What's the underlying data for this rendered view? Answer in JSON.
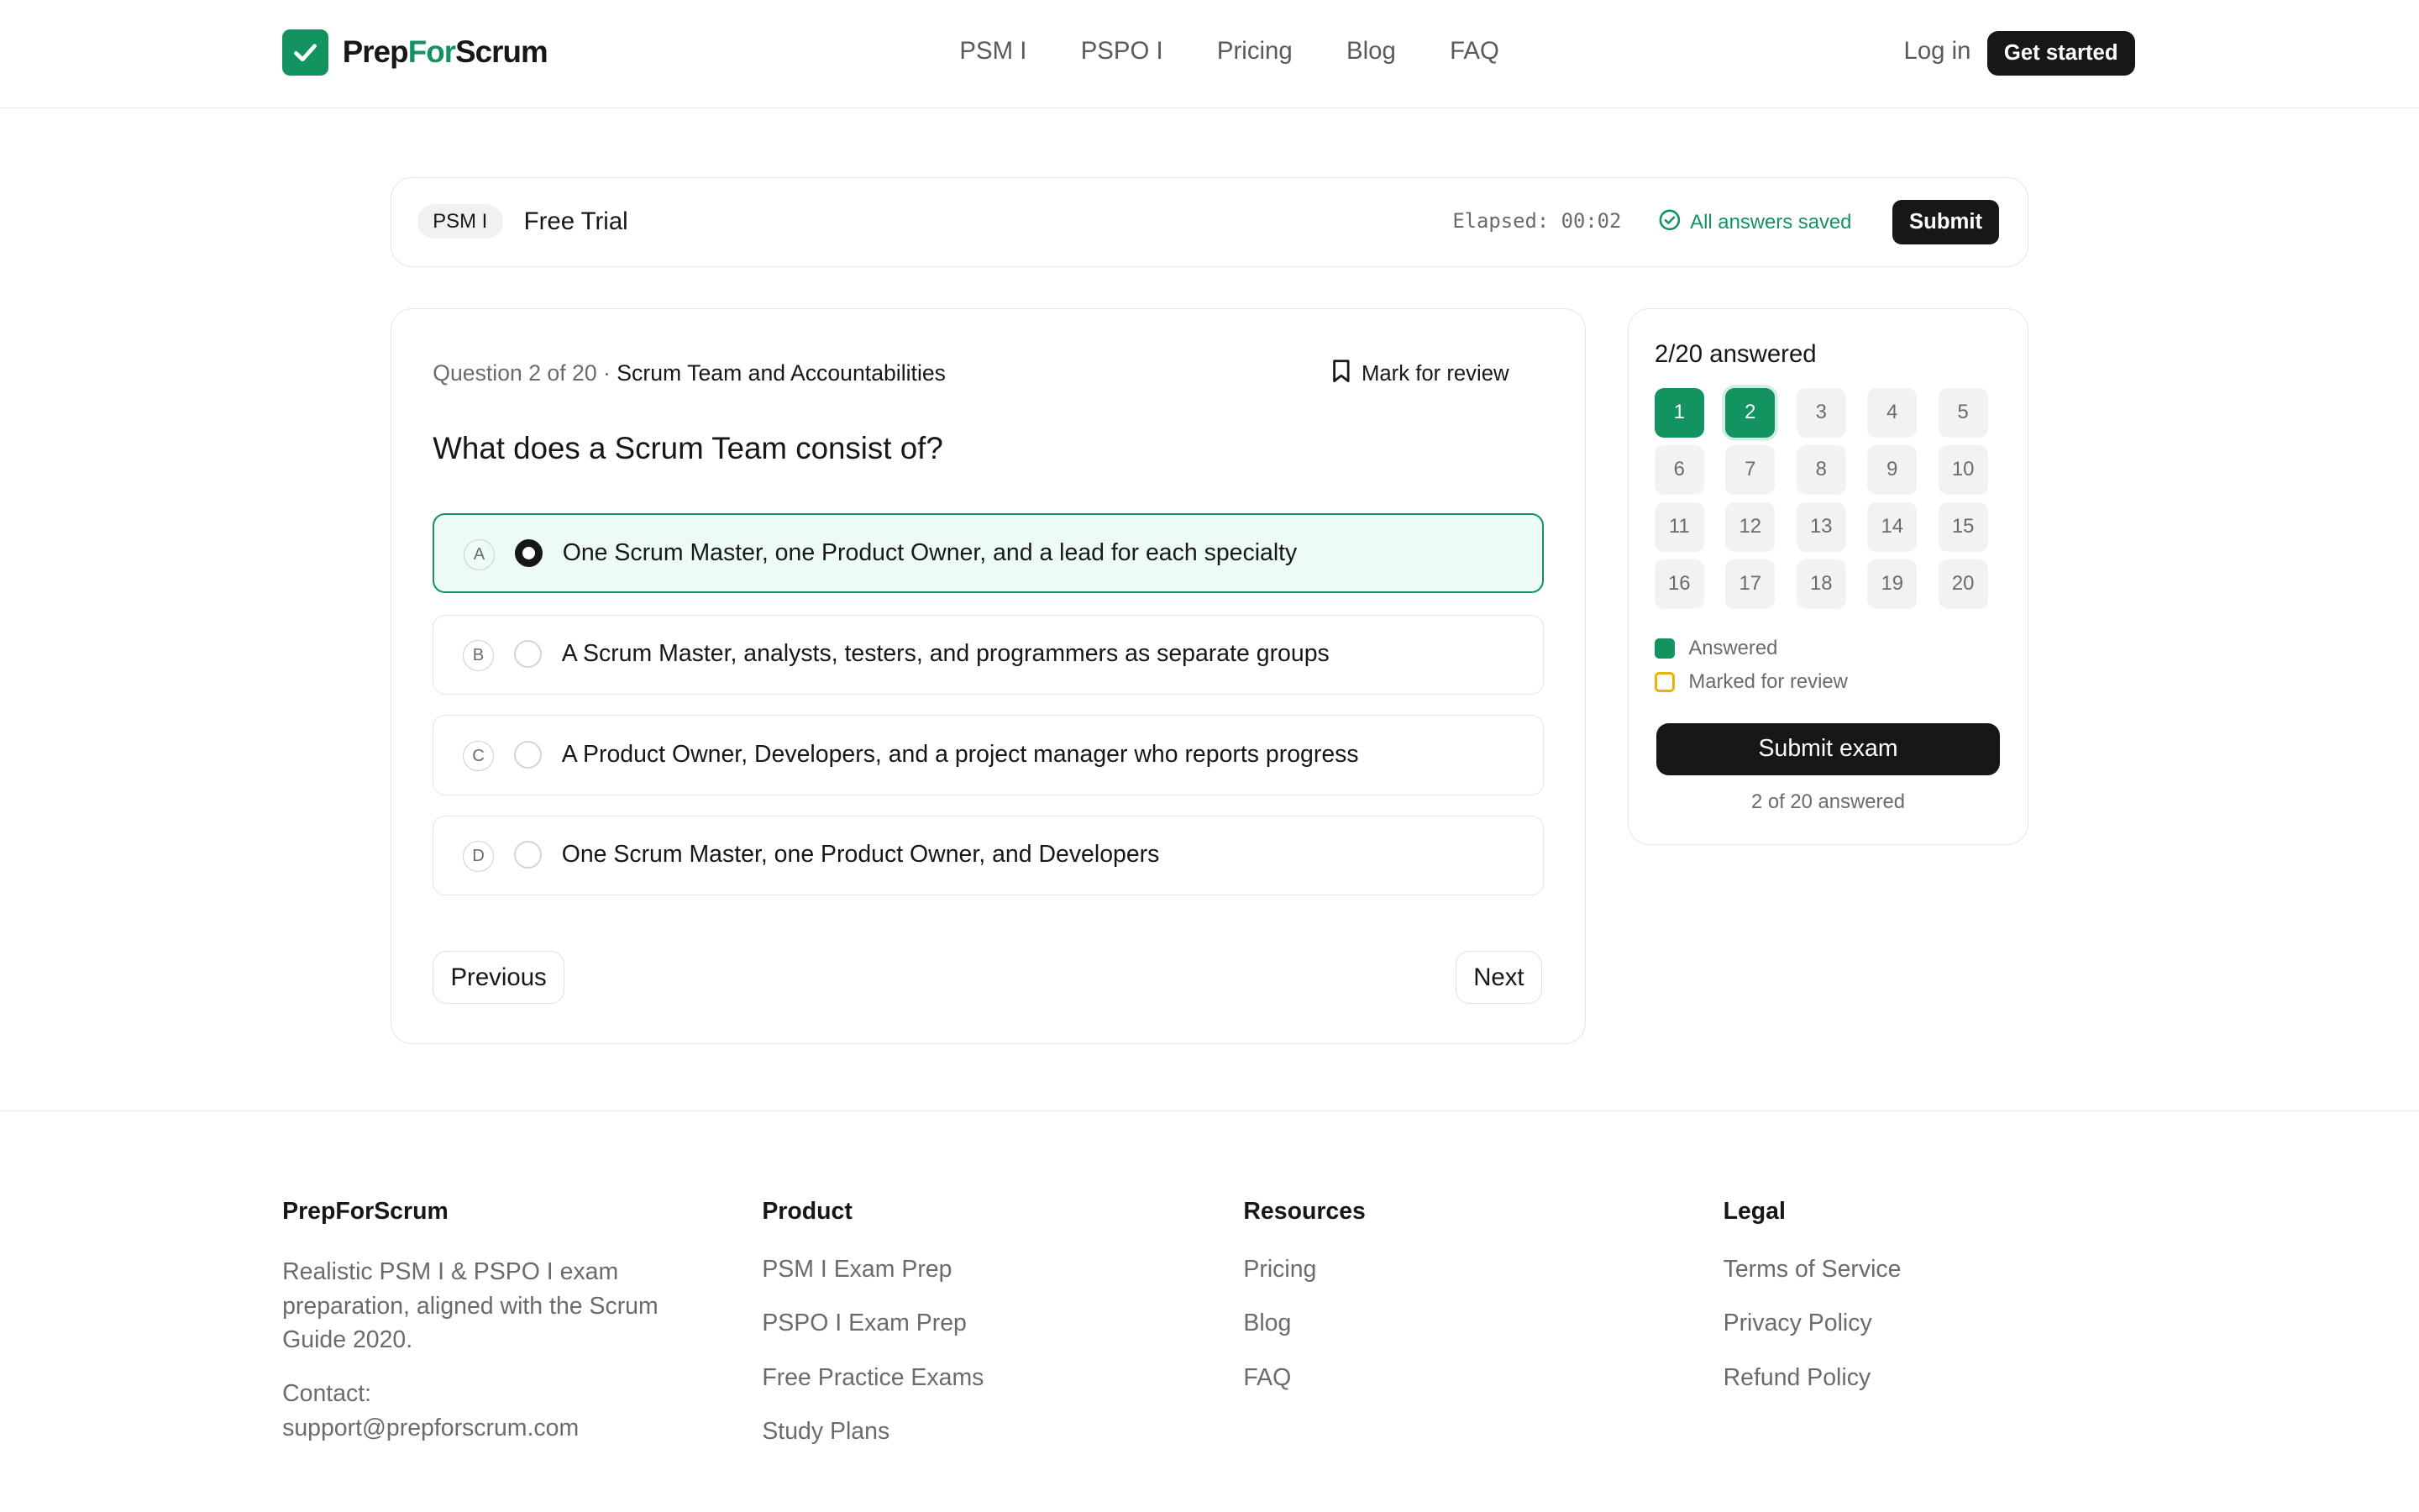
{
  "brand": {
    "name_part1": "Prep",
    "name_accent": "For",
    "name_part2": "Scrum",
    "accent_color": "#12935f"
  },
  "nav": {
    "items": [
      "PSM I",
      "PSPO I",
      "Pricing",
      "Blog",
      "FAQ"
    ],
    "login": "Log in",
    "get_started": "Get started"
  },
  "topbar": {
    "badge": "PSM I",
    "title": "Free Trial",
    "elapsed": "Elapsed: 00:02",
    "saved": "All answers saved",
    "submit": "Submit"
  },
  "question": {
    "meta_prefix": "Question 2 of 20 · ",
    "category": "Scrum Team and Accountabilities",
    "mark_review": "Mark for review",
    "text": "What does a Scrum Team consist of?",
    "selected": "A",
    "options": [
      {
        "letter": "A",
        "text": "One Scrum Master, one Product Owner, and a lead for each specialty"
      },
      {
        "letter": "B",
        "text": "A Scrum Master, analysts, testers, and programmers as separate groups"
      },
      {
        "letter": "C",
        "text": "A Product Owner, Developers, and a project manager who reports progress"
      },
      {
        "letter": "D",
        "text": "One Scrum Master, one Product Owner, and Developers"
      }
    ],
    "previous": "Previous",
    "next": "Next"
  },
  "sidebar": {
    "title": "2/20 answered",
    "numbers": [
      "1",
      "2",
      "3",
      "4",
      "5",
      "6",
      "7",
      "8",
      "9",
      "10",
      "11",
      "12",
      "13",
      "14",
      "15",
      "16",
      "17",
      "18",
      "19",
      "20"
    ],
    "answered": [
      1,
      2
    ],
    "current": 2,
    "legend_answered": "Answered",
    "legend_review": "Marked for review",
    "submit_exam": "Submit exam",
    "answered_note": "2 of 20 answered"
  },
  "footer": {
    "brand": {
      "title": "PrepForScrum",
      "desc": "Realistic PSM I & PSPO I exam preparation, aligned with the Scrum Guide 2020.",
      "contact_label": "Contact:",
      "contact_email": "support@prepforscrum.com"
    },
    "product": {
      "title": "Product",
      "links": [
        "PSM I Exam Prep",
        "PSPO I Exam Prep",
        "Free Practice Exams",
        "Study Plans"
      ]
    },
    "resources": {
      "title": "Resources",
      "links": [
        "Pricing",
        "Blog",
        "FAQ"
      ]
    },
    "legal": {
      "title": "Legal",
      "links": [
        "Terms of Service",
        "Privacy Policy",
        "Refund Policy"
      ]
    }
  }
}
